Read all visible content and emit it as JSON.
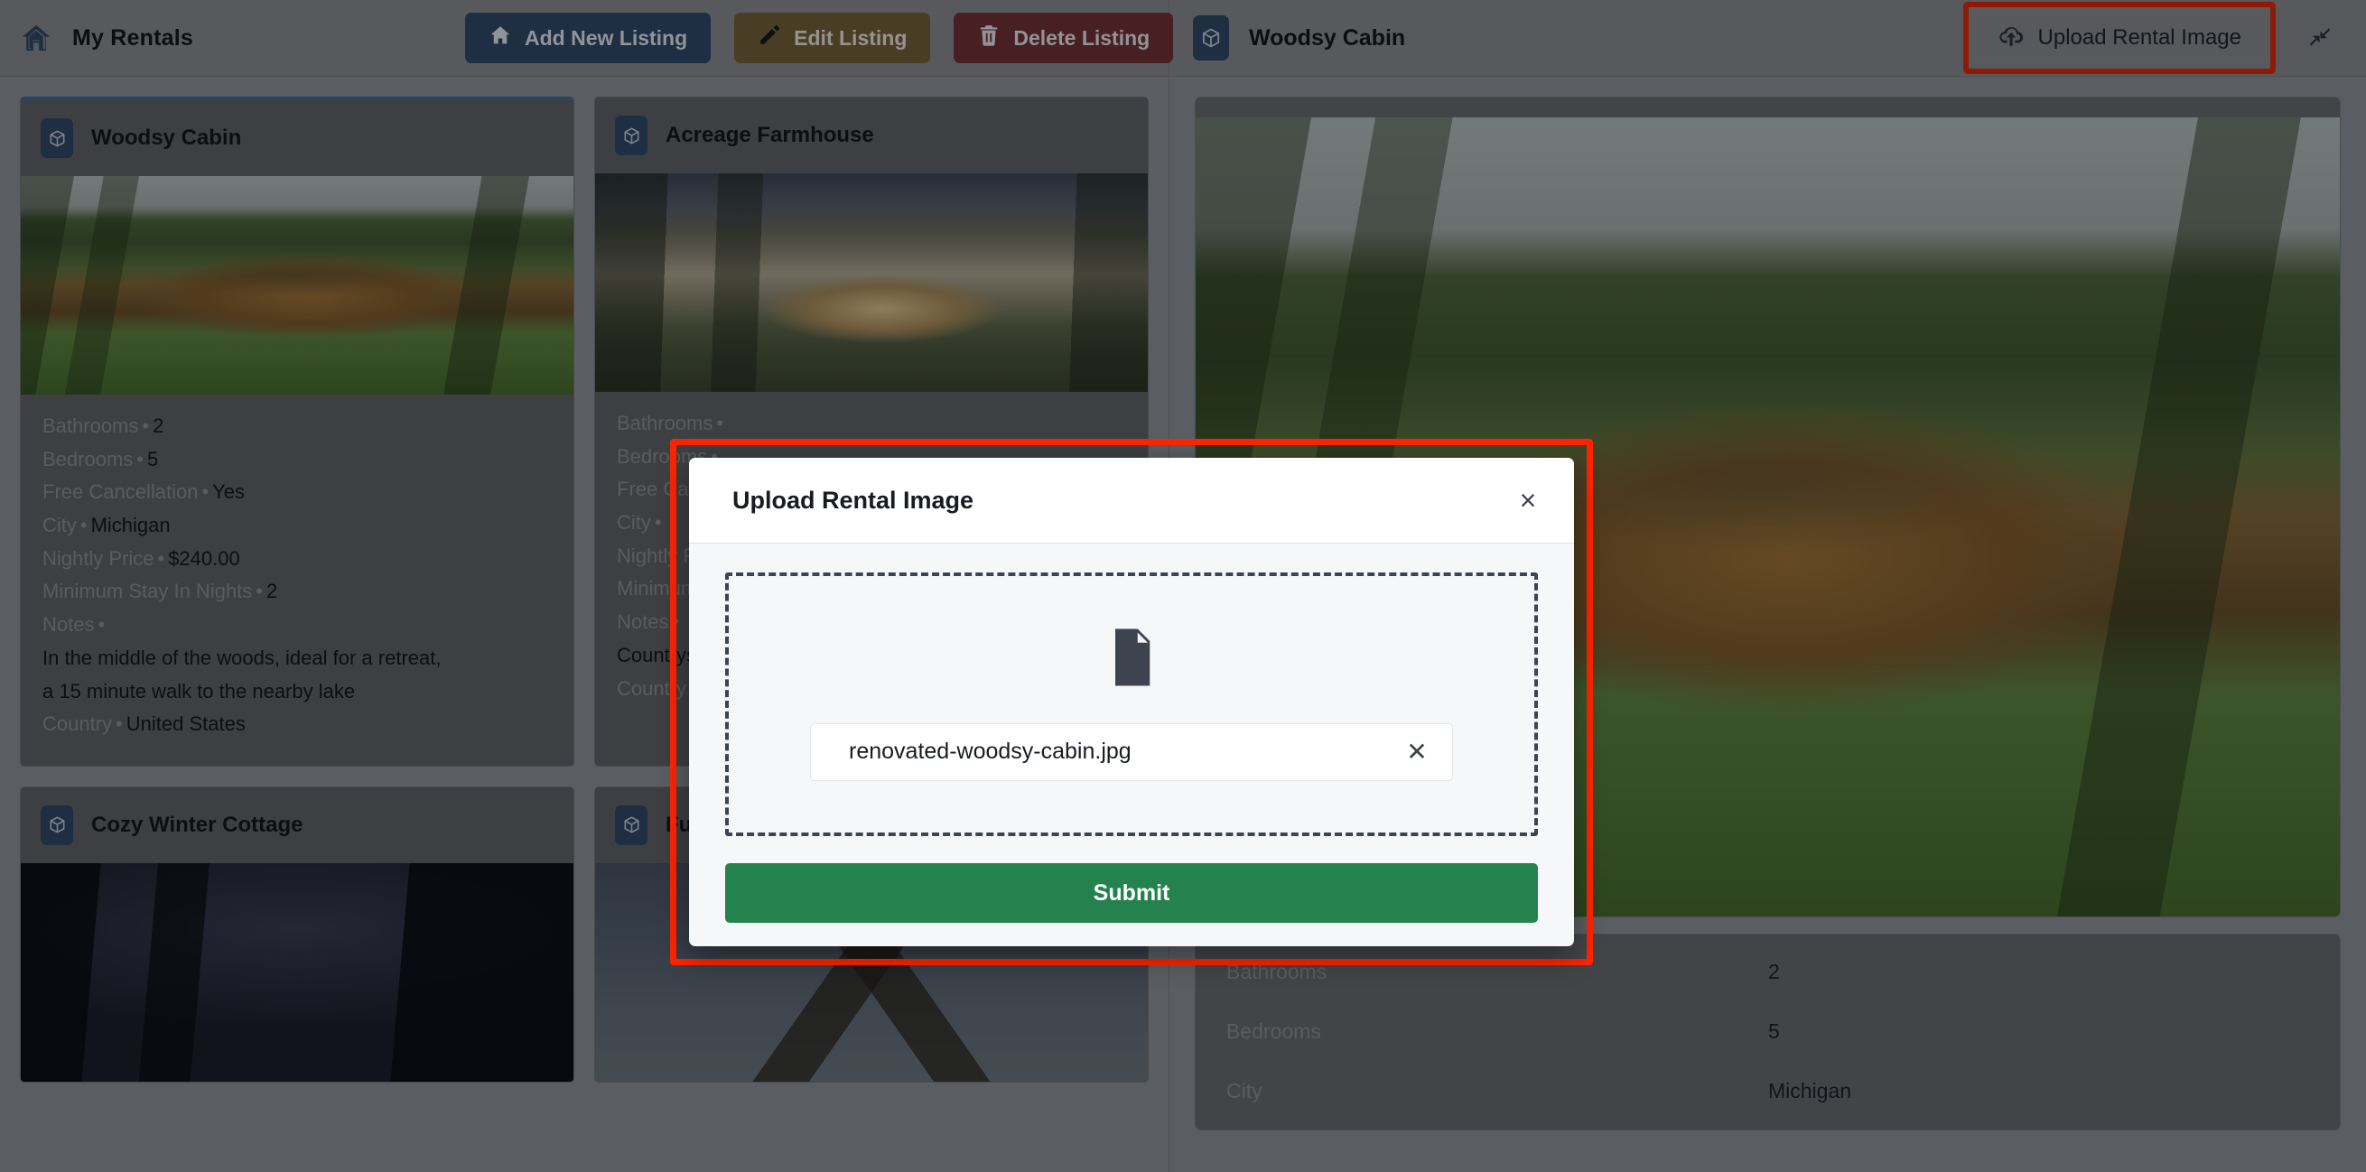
{
  "topbar": {
    "home_icon": "home-icon",
    "app_title": "My Rentals",
    "buttons": [
      {
        "label": "Add New Listing",
        "icon": "home-icon",
        "variant": "add"
      },
      {
        "label": "Edit Listing",
        "icon": "pencil-icon",
        "variant": "edit"
      },
      {
        "label": "Delete Listing",
        "icon": "trash-icon",
        "variant": "delete"
      }
    ],
    "detail_title": "Woodsy Cabin",
    "detail_icon": "cube-icon",
    "upload_button": {
      "label": "Upload Rental Image",
      "icon": "cloud-upload-icon"
    },
    "collapse_icon": "collapse-arrows-icon"
  },
  "listings": [
    {
      "title": "Woodsy Cabin",
      "icon": "cube-icon",
      "photo": "ph-cabin",
      "selected": true,
      "specs": [
        {
          "k": "Bathrooms",
          "v": "2"
        },
        {
          "k": "Bedrooms",
          "v": "5"
        },
        {
          "k": "Free Cancellation",
          "v": "Yes"
        },
        {
          "k": "City",
          "v": "Michigan"
        },
        {
          "k": "Nightly Price",
          "v": "$240.00"
        },
        {
          "k": "Minimum Stay In Nights",
          "v": "2"
        },
        {
          "k": "Notes",
          "v": ""
        }
      ],
      "note_line_1": "In the middle of the woods, ideal for a retreat,",
      "note_line_2": "a 15 minute walk to the nearby lake",
      "country_k": "Country",
      "country_v": "United States"
    },
    {
      "title": "Acreage Farmhouse",
      "icon": "cube-icon",
      "photo": "ph-farm",
      "selected": false,
      "specs": [
        {
          "k": "Bathrooms",
          "v": ""
        },
        {
          "k": "Bedrooms",
          "v": ""
        },
        {
          "k": "Free Cancellation",
          "v": ""
        },
        {
          "k": "City",
          "v": ""
        },
        {
          "k": "Nightly Price",
          "v": ""
        },
        {
          "k": "Minimum Stay In Nights",
          "v": ""
        },
        {
          "k": "Notes",
          "v": ""
        }
      ],
      "note_line_1": "Countryside escape surrounded by open fields,",
      "note_line_2": "",
      "country_k": "Country",
      "country_v": ""
    },
    {
      "title": "Cozy Winter Cottage",
      "icon": "cube-icon",
      "photo": "ph-winter",
      "selected": false,
      "specs": [],
      "note_line_1": "",
      "note_line_2": "",
      "country_k": "",
      "country_v": ""
    },
    {
      "title": "Funky Cubist House",
      "icon": "cube-icon",
      "photo": "ph-cubist",
      "selected": false,
      "specs": [],
      "note_line_1": "",
      "note_line_2": "",
      "country_k": "",
      "country_v": ""
    }
  ],
  "detail": {
    "hero_photo": "ph-cabin",
    "specs": [
      {
        "k": "Bathrooms",
        "v": "2"
      },
      {
        "k": "Bedrooms",
        "v": "5"
      },
      {
        "k": "City",
        "v": "Michigan"
      }
    ]
  },
  "modal": {
    "title": "Upload Rental Image",
    "icon": "cloud-upload-icon",
    "close_label": "×",
    "dropzone_icon": "document-icon",
    "file": {
      "icon": "document-icon",
      "name": "renovated-woodsy-cabin.jpg",
      "remove_label": "✕"
    },
    "submit_label": "Submit"
  },
  "colors": {
    "highlight": "#ff2400",
    "accent_blue": "#2c4a73",
    "edit_brown": "#7a6234",
    "delete_red": "#7d2f38",
    "submit_green": "#23824d"
  }
}
